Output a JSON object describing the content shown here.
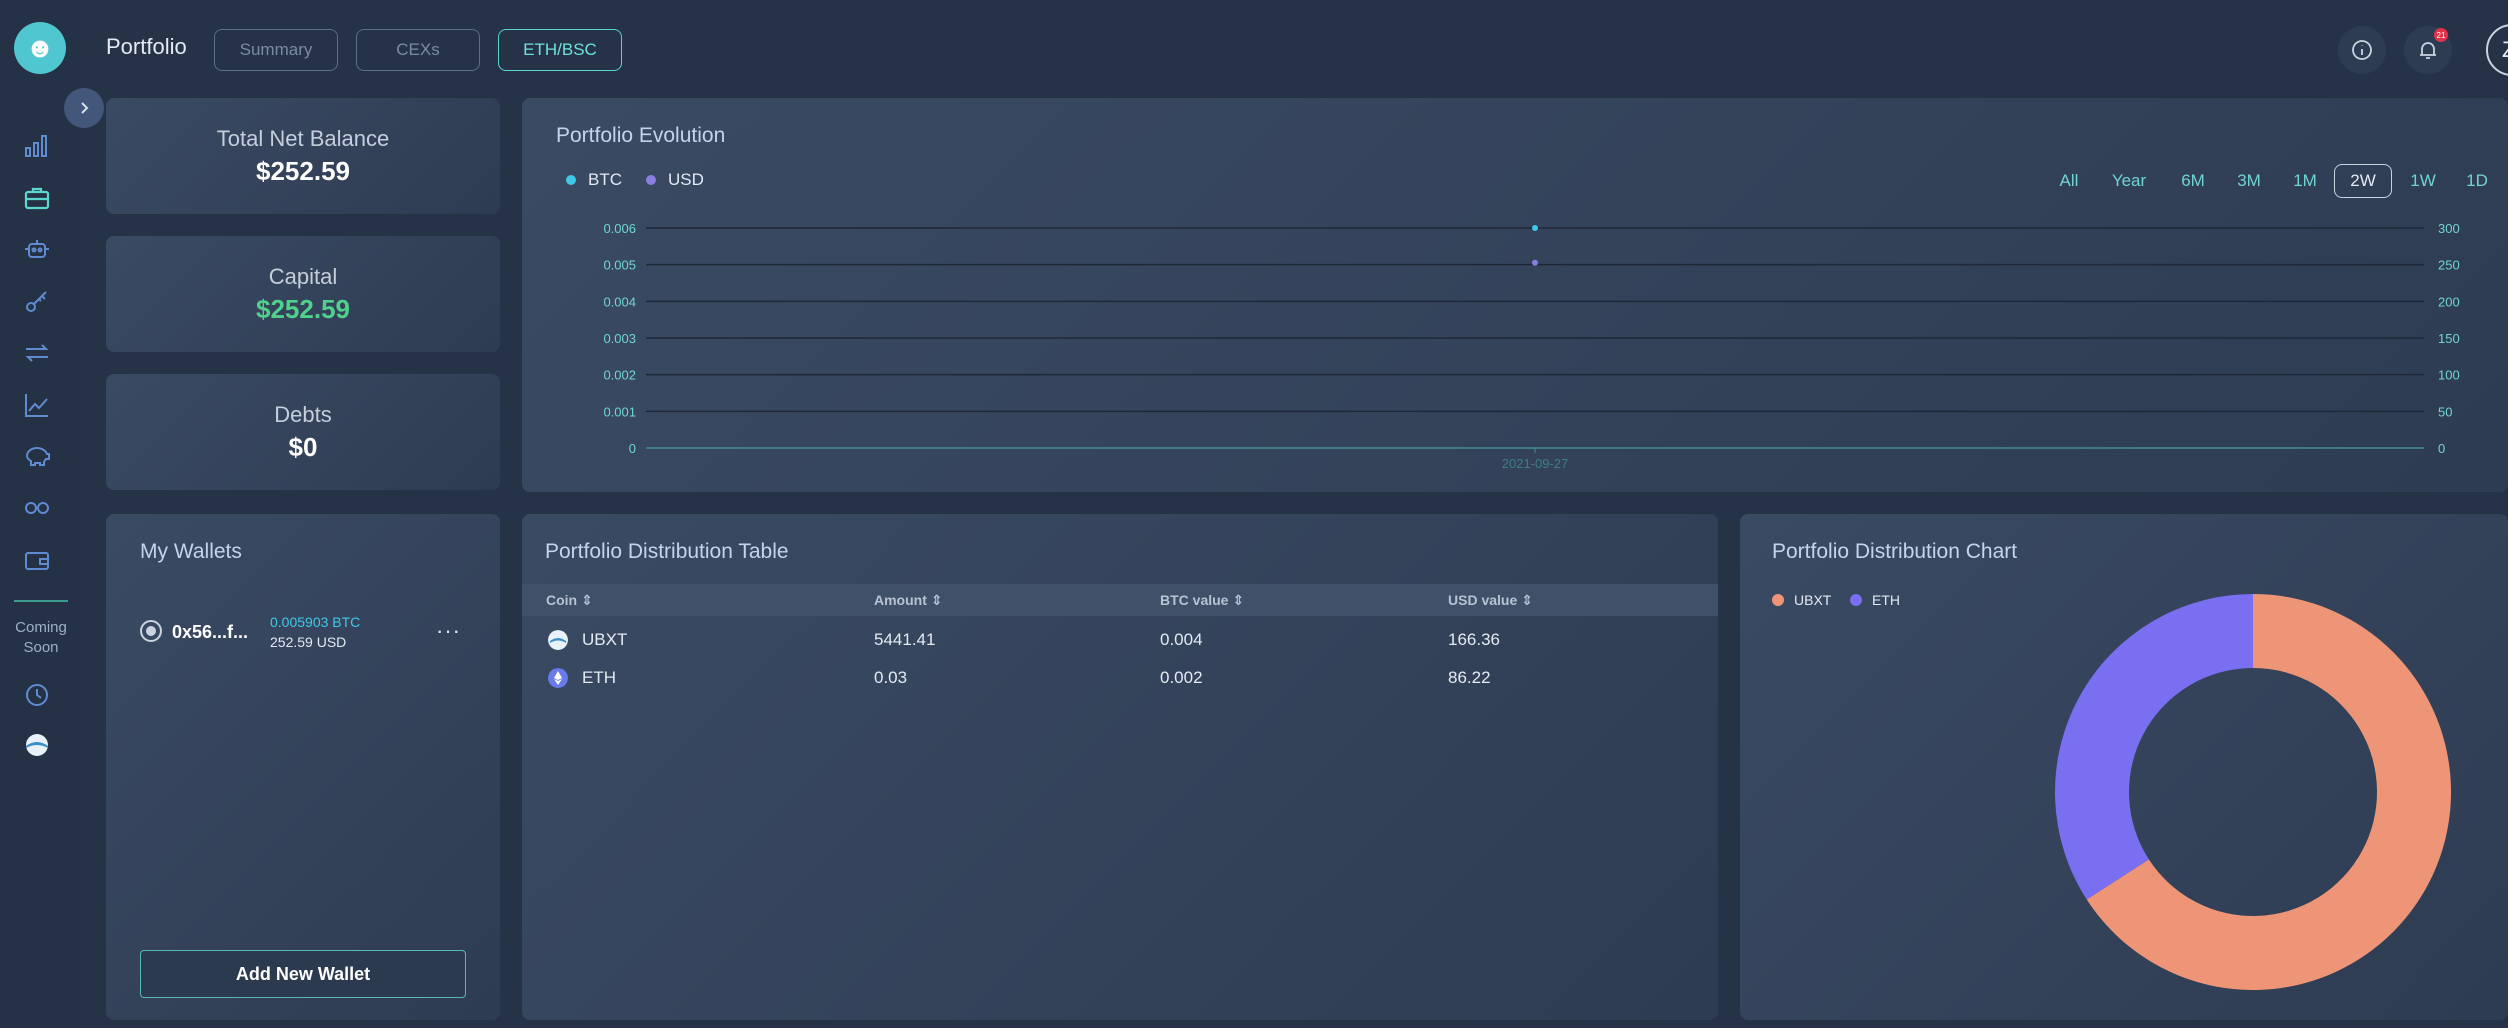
{
  "header": {
    "title": "Portfolio",
    "tabs": [
      {
        "label": "Summary"
      },
      {
        "label": "CEXs"
      },
      {
        "label": "ETH/BSC"
      }
    ],
    "notification_count": "21",
    "avatar_letter": "Z"
  },
  "sidebar": {
    "coming_soon": "Coming Soon",
    "icons": [
      "bar-chart-icon",
      "briefcase-icon",
      "robot-icon",
      "key-icon",
      "swap-icon",
      "line-chart-icon",
      "piggy-bank-icon",
      "infinity-icon",
      "wallet-icon",
      "clock-icon",
      "ubxt-icon"
    ]
  },
  "stats": {
    "total_label": "Total Net Balance",
    "total_value": "$252.59",
    "capital_label": "Capital",
    "capital_value": "$252.59",
    "debts_label": "Debts",
    "debts_value": "$0"
  },
  "evolution": {
    "title": "Portfolio Evolution",
    "legend": [
      {
        "name": "BTC",
        "color": "#3ec9e6"
      },
      {
        "name": "USD",
        "color": "#8a7fe0"
      }
    ],
    "ranges": [
      "All",
      "Year",
      "6M",
      "3M",
      "1M",
      "2W",
      "1W",
      "1D"
    ],
    "active_range": "2W"
  },
  "wallets": {
    "title": "My Wallets",
    "items": [
      {
        "address": "0x56...f...",
        "btc": "0.005903 BTC",
        "usd": "252.59 USD"
      }
    ],
    "add_button": "Add New Wallet"
  },
  "dist_table": {
    "title": "Portfolio Distribution Table",
    "columns": [
      "Coin",
      "Amount",
      "BTC value",
      "USD value"
    ],
    "rows": [
      {
        "coin": "UBXT",
        "amount": "5441.41",
        "btc": "0.004",
        "usd": "166.36"
      },
      {
        "coin": "ETH",
        "amount": "0.03",
        "btc": "0.002",
        "usd": "86.22"
      }
    ]
  },
  "dist_chart": {
    "title": "Portfolio Distribution Chart",
    "legend": [
      {
        "name": "UBXT",
        "color": "#ef9577"
      },
      {
        "name": "ETH",
        "color": "#7a6ff0"
      }
    ]
  },
  "chart_data": [
    {
      "type": "scatter",
      "title": "Portfolio Evolution",
      "x": [
        "2021-09-27"
      ],
      "series": [
        {
          "name": "BTC",
          "values": [
            0.006
          ],
          "axis": "left"
        },
        {
          "name": "USD",
          "values": [
            252.59
          ],
          "axis": "right"
        }
      ],
      "yticks_left": [
        "0",
        "0.001",
        "0.002",
        "0.003",
        "0.004",
        "0.005",
        "0.006"
      ],
      "yticks_right": [
        "0",
        "50",
        "100",
        "150",
        "200",
        "250",
        "300"
      ],
      "xticks": [
        "2021-09-27"
      ],
      "ylim_left": [
        0,
        0.006
      ],
      "ylim_right": [
        0,
        300
      ],
      "grid": true,
      "legend": "top-left"
    },
    {
      "type": "pie",
      "title": "Portfolio Distribution Chart",
      "categories": [
        "UBXT",
        "ETH"
      ],
      "values": [
        166.36,
        86.22
      ],
      "donut": true,
      "legend": "top-left"
    }
  ]
}
